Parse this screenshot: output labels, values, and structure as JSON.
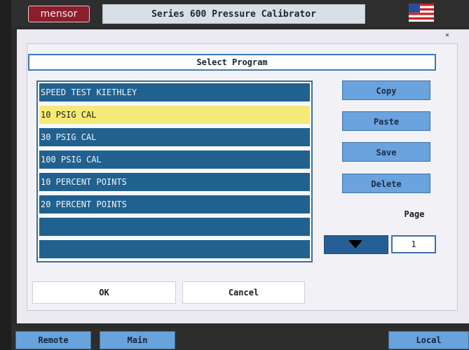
{
  "header": {
    "logo_text": "mensor",
    "title": "Series 600 Pressure Calibrator"
  },
  "dialog": {
    "title": "Select Program",
    "programs": [
      {
        "label": "SPEED TEST KIETHLEY"
      },
      {
        "label": "10 PSIG CAL"
      },
      {
        "label": "30 PSIG CAL"
      },
      {
        "label": "100 PSIG CAL"
      },
      {
        "label": "10 PERCENT POINTS"
      },
      {
        "label": "20 PERCENT POINTS"
      },
      {
        "label": ""
      },
      {
        "label": ""
      }
    ],
    "selected_program": "10 PSIG CAL",
    "buttons": {
      "copy": "Copy",
      "paste": "Paste",
      "save": "Save",
      "delete": "Delete"
    },
    "page_label": "Page",
    "page_value": "1",
    "ok": "OK",
    "cancel": "Cancel"
  },
  "status_bar": {
    "remote": "Remote",
    "main": "Main",
    "local": "Local"
  },
  "colors": {
    "list_item": "#21618f",
    "selected_item": "#f5ea78",
    "button": "#6aa3de",
    "accent_border": "#3f78b7"
  },
  "icons": [
    "flag-icon",
    "down-arrow-icon",
    "close-icon"
  ]
}
